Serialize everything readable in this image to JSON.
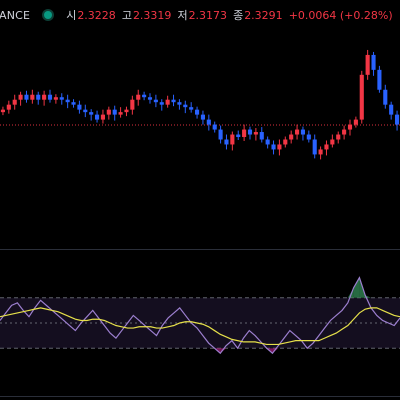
{
  "legend": {
    "symbol": "ANCE",
    "open_label": "시",
    "open_value": "2.3228",
    "high_label": "고",
    "high_value": "2.3319",
    "low_label": "저",
    "low_value": "2.3173",
    "close_label": "종",
    "close_value": "2.3291",
    "change": "+0.0064 (+0.28%)"
  },
  "colors": {
    "up": "#f23645",
    "down": "#2962ff",
    "rsi_line": "#9c7fcf",
    "rsi_ma": "#e6e04a",
    "rsi_band": "rgba(126,87,194,0.16)",
    "overbought_fill": "#2e7d4e",
    "oversold_fill": "#8e1a6a",
    "price_line": "#f23645"
  },
  "price_chart": {
    "last_price_line": 2.3291,
    "closes": [
      2.36,
      2.37,
      2.38,
      2.39,
      2.38,
      2.39,
      2.38,
      2.39,
      2.38,
      2.385,
      2.38,
      2.375,
      2.37,
      2.36,
      2.355,
      2.35,
      2.34,
      2.35,
      2.36,
      2.35,
      2.355,
      2.36,
      2.38,
      2.39,
      2.385,
      2.38,
      2.375,
      2.37,
      2.38,
      2.375,
      2.37,
      2.365,
      2.36,
      2.35,
      2.34,
      2.33,
      2.32,
      2.3,
      2.29,
      2.31,
      2.305,
      2.32,
      2.31,
      2.315,
      2.3,
      2.29,
      2.28,
      2.29,
      2.3,
      2.31,
      2.32,
      2.31,
      2.3,
      2.27,
      2.28,
      2.29,
      2.3,
      2.31,
      2.32,
      2.33,
      2.34,
      2.43,
      2.47,
      2.44,
      2.4,
      2.37,
      2.35,
      2.33
    ],
    "ylim": [
      2.1,
      2.5
    ]
  },
  "rsi_panel": {
    "levels": [
      70,
      50,
      30
    ],
    "rsi": [
      52,
      58,
      64,
      66,
      60,
      55,
      62,
      68,
      64,
      60,
      56,
      52,
      48,
      44,
      50,
      55,
      60,
      54,
      48,
      42,
      38,
      44,
      50,
      56,
      52,
      48,
      44,
      40,
      48,
      54,
      58,
      62,
      56,
      50,
      46,
      40,
      34,
      30,
      26,
      32,
      36,
      30,
      38,
      44,
      40,
      35,
      30,
      26,
      32,
      38,
      44,
      40,
      36,
      30,
      34,
      40,
      46,
      52,
      56,
      60,
      66,
      78,
      86,
      72,
      62,
      56,
      52,
      50,
      48,
      54
    ],
    "rsi_ma": [
      55,
      56,
      57,
      58,
      59,
      60,
      61,
      62,
      61,
      60,
      59,
      57,
      55,
      53,
      52,
      52,
      53,
      53,
      52,
      50,
      48,
      47,
      46,
      46,
      47,
      47,
      47,
      46,
      46,
      47,
      48,
      50,
      51,
      51,
      50,
      49,
      47,
      44,
      41,
      39,
      37,
      36,
      35,
      35,
      35,
      34,
      33,
      33,
      33,
      34,
      35,
      36,
      36,
      36,
      36,
      36,
      38,
      40,
      42,
      45,
      48,
      53,
      58,
      61,
      62,
      62,
      60,
      58,
      56,
      55
    ],
    "ylim": [
      0,
      100
    ]
  }
}
